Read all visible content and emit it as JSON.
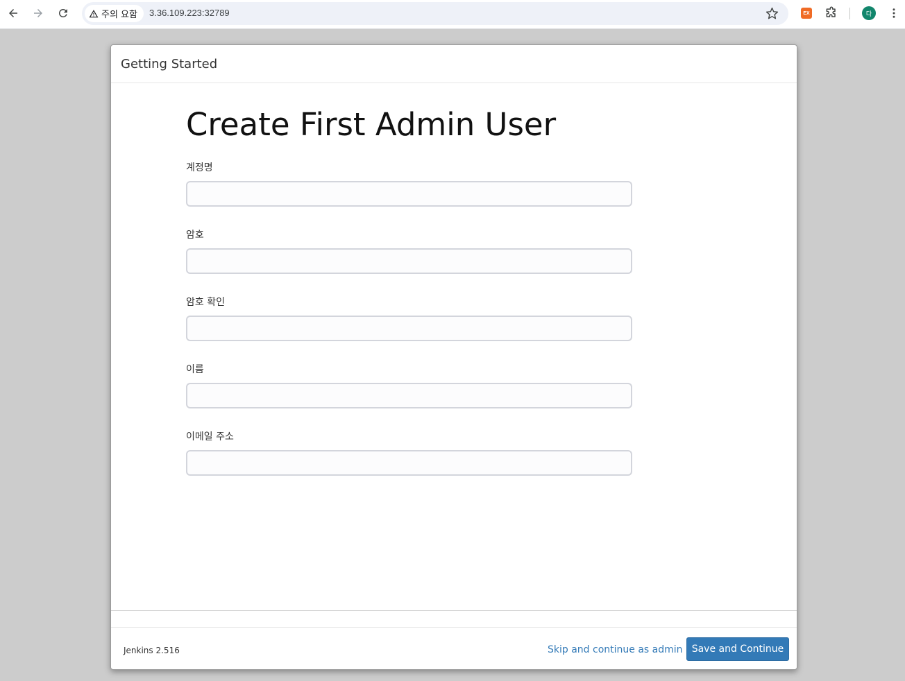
{
  "browser": {
    "security_label": "주의 요함",
    "url": "3.36.109.223:32789",
    "avatar_letter": "다",
    "extension_label": "EX"
  },
  "dialog": {
    "header_title": "Getting Started",
    "heading": "Create First Admin User",
    "fields": [
      {
        "label": "계정명",
        "value": ""
      },
      {
        "label": "암호",
        "value": ""
      },
      {
        "label": "암호 확인",
        "value": ""
      },
      {
        "label": "이름",
        "value": ""
      },
      {
        "label": "이메일 주소",
        "value": ""
      }
    ],
    "footer": {
      "version": "Jenkins 2.516",
      "skip_label": "Skip and continue as admin",
      "save_label": "Save and Continue"
    }
  },
  "colors": {
    "primary_button": "#337ab7",
    "link": "#337ab7",
    "page_background": "#cccccc"
  }
}
